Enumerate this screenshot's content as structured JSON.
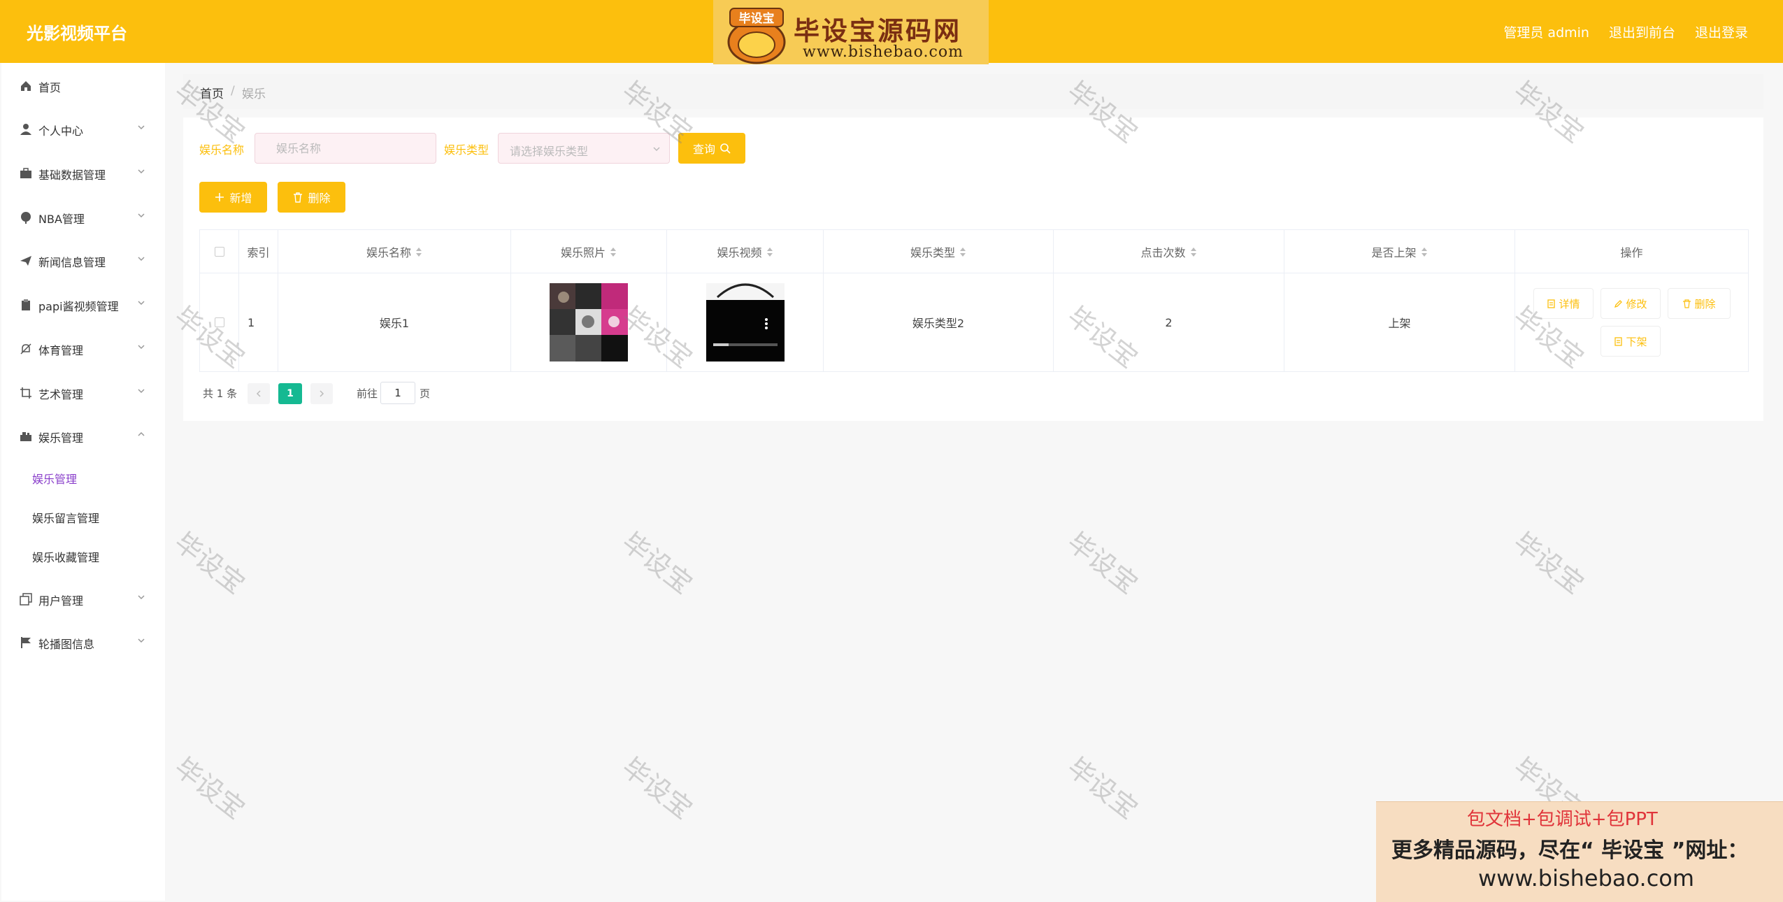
{
  "header": {
    "brand": "光影视频平台",
    "admin_label": "管理员 admin",
    "to_front_label": "退出到前台",
    "logout_label": "退出登录",
    "logo_badge_text": "毕设宝",
    "logo_title": "毕设宝源码网",
    "logo_url": "www.bishebao.com"
  },
  "sidebar": {
    "items": [
      {
        "label": "首页",
        "icon": "home-icon"
      },
      {
        "label": "个人中心",
        "icon": "user-icon"
      },
      {
        "label": "基础数据管理",
        "icon": "briefcase-icon"
      },
      {
        "label": "NBA管理",
        "icon": "ball-icon"
      },
      {
        "label": "新闻信息管理",
        "icon": "send-icon"
      },
      {
        "label": "papi酱视频管理",
        "icon": "clipboard-icon"
      },
      {
        "label": "体育管理",
        "icon": "bell-off-icon"
      },
      {
        "label": "艺术管理",
        "icon": "crop-icon"
      },
      {
        "label": "娱乐管理",
        "icon": "suitcase-icon"
      },
      {
        "label": "用户管理",
        "icon": "copy-icon"
      },
      {
        "label": "轮播图信息",
        "icon": "flag-icon"
      }
    ],
    "sub_items": [
      "娱乐管理",
      "娱乐留言管理",
      "娱乐收藏管理"
    ]
  },
  "breadcrumb": {
    "home": "首页",
    "separator": "/",
    "current": "娱乐"
  },
  "filters": {
    "name_label": "娱乐名称",
    "name_placeholder": "娱乐名称",
    "type_label": "娱乐类型",
    "type_placeholder": "请选择娱乐类型",
    "search_button": "查询"
  },
  "actions": {
    "add_label": "新增",
    "delete_label": "删除"
  },
  "table": {
    "headers": [
      "索引",
      "娱乐名称",
      "娱乐照片",
      "娱乐视频",
      "娱乐类型",
      "点击次数",
      "是否上架",
      "操作"
    ],
    "rows": [
      {
        "index": "1",
        "name": "娱乐1",
        "type": "娱乐类型2",
        "clicks": "2",
        "status": "上架",
        "ops": [
          "详情",
          "修改",
          "删除",
          "下架"
        ]
      }
    ]
  },
  "pagination": {
    "total": "共 1 条",
    "current_page": "1",
    "goto_label": "前往",
    "goto_value": "1",
    "page_suffix": "页"
  },
  "watermark": "毕设宝",
  "promo": {
    "line1": "包文档+包调试+包PPT",
    "line2": "更多精品源码，尽在“ 毕设宝 ”网址：",
    "line3": "www.bishebao.com"
  },
  "colors": {
    "accent": "#fcbf0d",
    "active_submenu": "#8a3fcb",
    "page_active": "#15b992"
  }
}
